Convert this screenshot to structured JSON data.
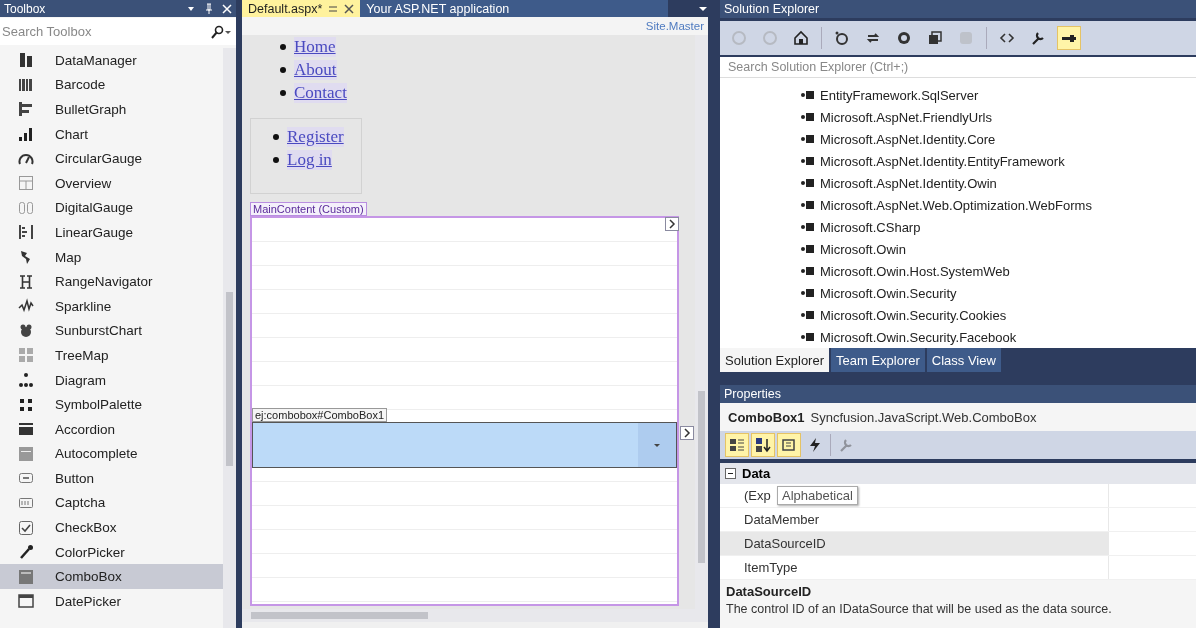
{
  "toolbox": {
    "title": "Toolbox",
    "search": {
      "placeholder": "Search Toolbox"
    },
    "items": [
      {
        "label": "DataManager",
        "selected": false
      },
      {
        "label": "Barcode",
        "selected": false
      },
      {
        "label": "BulletGraph",
        "selected": false
      },
      {
        "label": "Chart",
        "selected": false
      },
      {
        "label": "CircularGauge",
        "selected": false
      },
      {
        "label": "Overview",
        "selected": false
      },
      {
        "label": "DigitalGauge",
        "selected": false
      },
      {
        "label": "LinearGauge",
        "selected": false
      },
      {
        "label": "Map",
        "selected": false
      },
      {
        "label": "RangeNavigator",
        "selected": false
      },
      {
        "label": "Sparkline",
        "selected": false
      },
      {
        "label": "SunburstChart",
        "selected": false
      },
      {
        "label": "TreeMap",
        "selected": false
      },
      {
        "label": "Diagram",
        "selected": false
      },
      {
        "label": "SymbolPalette",
        "selected": false
      },
      {
        "label": "Accordion",
        "selected": false
      },
      {
        "label": "Autocomplete",
        "selected": false
      },
      {
        "label": "Button",
        "selected": false
      },
      {
        "label": "Captcha",
        "selected": false
      },
      {
        "label": "CheckBox",
        "selected": false
      },
      {
        "label": "ColorPicker",
        "selected": false
      },
      {
        "label": "ComboBox",
        "selected": true
      },
      {
        "label": "DatePicker",
        "selected": false
      }
    ]
  },
  "editor": {
    "tabs": [
      {
        "label": "Default.aspx*",
        "selected": true
      },
      {
        "label": "Your ASP.NET application",
        "selected": false
      }
    ],
    "master_label": "Site.Master",
    "nav_links": [
      "Home",
      "About",
      "Contact"
    ],
    "account_links": [
      "Register",
      "Log in"
    ],
    "content_placeholder": {
      "label": "MainContent (Custom)"
    },
    "control": {
      "label": "ej:combobox#ComboBox1",
      "selected": true
    }
  },
  "solution_explorer": {
    "title": "Solution Explorer",
    "toolbar": [
      {
        "kind": "back",
        "selected": false,
        "disabled": true
      },
      {
        "kind": "forward",
        "selected": false,
        "disabled": true
      },
      {
        "kind": "home",
        "selected": false,
        "disabled": false
      },
      {
        "kind": "sync",
        "selected": false,
        "disabled": false
      },
      {
        "kind": "switch",
        "selected": false,
        "disabled": false
      },
      {
        "kind": "refresh",
        "selected": false,
        "disabled": false
      },
      {
        "kind": "collapse",
        "selected": false,
        "disabled": false
      },
      {
        "kind": "show-all",
        "selected": false,
        "disabled": true
      },
      {
        "kind": "code",
        "selected": false,
        "disabled": false
      },
      {
        "kind": "properties",
        "selected": false,
        "disabled": false
      },
      {
        "kind": "preview",
        "selected": true,
        "disabled": false
      }
    ],
    "search": {
      "placeholder": "Search Solution Explorer (Ctrl+;)"
    },
    "items": [
      "EntityFramework.SqlServer",
      "Microsoft.AspNet.FriendlyUrls",
      "Microsoft.AspNet.Identity.Core",
      "Microsoft.AspNet.Identity.EntityFramework",
      "Microsoft.AspNet.Identity.Owin",
      "Microsoft.AspNet.Web.Optimization.WebForms",
      "Microsoft.CSharp",
      "Microsoft.Owin",
      "Microsoft.Owin.Host.SystemWeb",
      "Microsoft.Owin.Security",
      "Microsoft.Owin.Security.Cookies",
      "Microsoft.Owin.Security.Facebook"
    ],
    "tabs": [
      {
        "label": "Solution Explorer",
        "selected": true
      },
      {
        "label": "Team Explorer",
        "selected": false
      },
      {
        "label": "Class View",
        "selected": false
      }
    ]
  },
  "properties": {
    "title": "Properties",
    "object_name": "ComboBox1",
    "object_type": "Syncfusion.JavaScript.Web.ComboBox",
    "toolbar": [
      {
        "kind": "categorized",
        "selected": true,
        "disabled": false
      },
      {
        "kind": "alphabetical",
        "selected": true,
        "disabled": false
      },
      {
        "kind": "properties",
        "selected": true,
        "disabled": false
      },
      {
        "kind": "events",
        "selected": false,
        "disabled": false
      },
      {
        "kind": "property-pages",
        "selected": false,
        "disabled": true
      }
    ],
    "category": {
      "label": "Data",
      "expanded": true
    },
    "rows": [
      {
        "name": "(Exp",
        "selected": false
      },
      {
        "name": "DataMember",
        "selected": false
      },
      {
        "name": "DataSourceID",
        "selected": true
      },
      {
        "name": "ItemType",
        "selected": false
      }
    ],
    "tooltip": "Alphabetical",
    "description": {
      "title": "DataSourceID",
      "text": "The control ID of an IDataSource that will be used as the data source."
    }
  }
}
